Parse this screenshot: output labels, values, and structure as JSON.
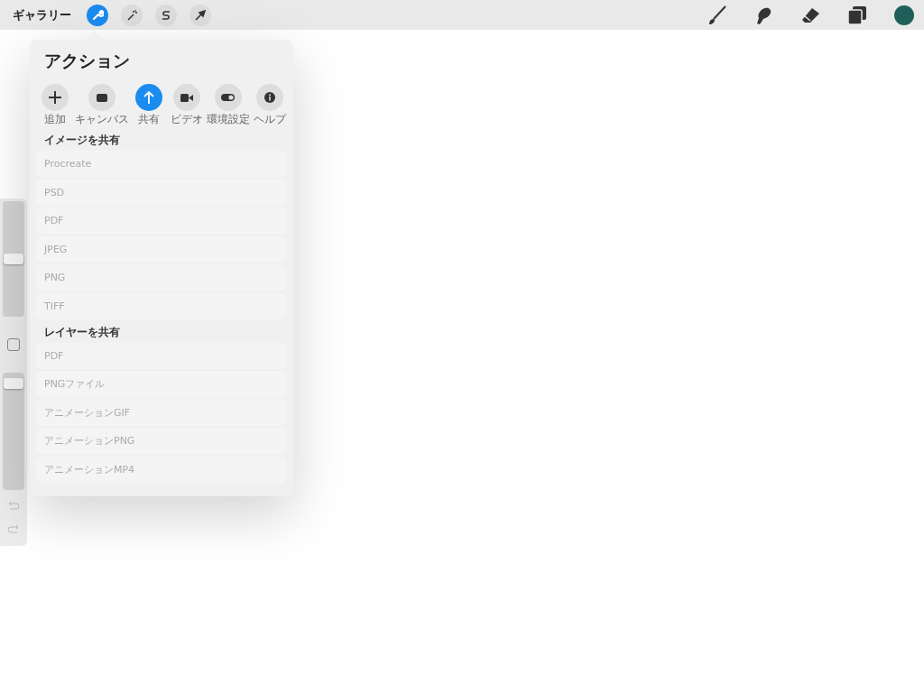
{
  "top_bar": {
    "gallery": "ギャラリー",
    "left_tools": [
      {
        "kind": "wrench",
        "selected": true
      },
      {
        "kind": "wand",
        "selected": false
      },
      {
        "kind": "selection",
        "selected": false
      },
      {
        "kind": "move",
        "selected": false
      }
    ],
    "right_tools": [
      {
        "kind": "brush"
      },
      {
        "kind": "smudge"
      },
      {
        "kind": "eraser"
      },
      {
        "kind": "layers"
      },
      {
        "kind": "color",
        "color": "#1f5f5a"
      }
    ]
  },
  "sidebar": {
    "size_slider": {
      "level": 0.5
    },
    "opacity_slider": {
      "level": 0.95
    }
  },
  "actions_panel": {
    "title": "アクション",
    "tabs": [
      {
        "kind": "add",
        "label": "追加",
        "selected": false
      },
      {
        "kind": "canvas",
        "label": "キャンバス",
        "selected": false
      },
      {
        "kind": "share",
        "label": "共有",
        "selected": true
      },
      {
        "kind": "video",
        "label": "ビデオ",
        "selected": false
      },
      {
        "kind": "prefs",
        "label": "環境設定",
        "selected": false
      },
      {
        "kind": "help",
        "label": "ヘルプ",
        "selected": false
      }
    ],
    "sections": [
      {
        "heading": "イメージを共有",
        "items": [
          "Procreate",
          "PSD",
          "PDF",
          "JPEG",
          "PNG",
          "TIFF"
        ]
      },
      {
        "heading": "レイヤーを共有",
        "items": [
          "PDF",
          "PNGファイル",
          "アニメーションGIF",
          "アニメーションPNG",
          "アニメーションMP4"
        ]
      }
    ]
  }
}
